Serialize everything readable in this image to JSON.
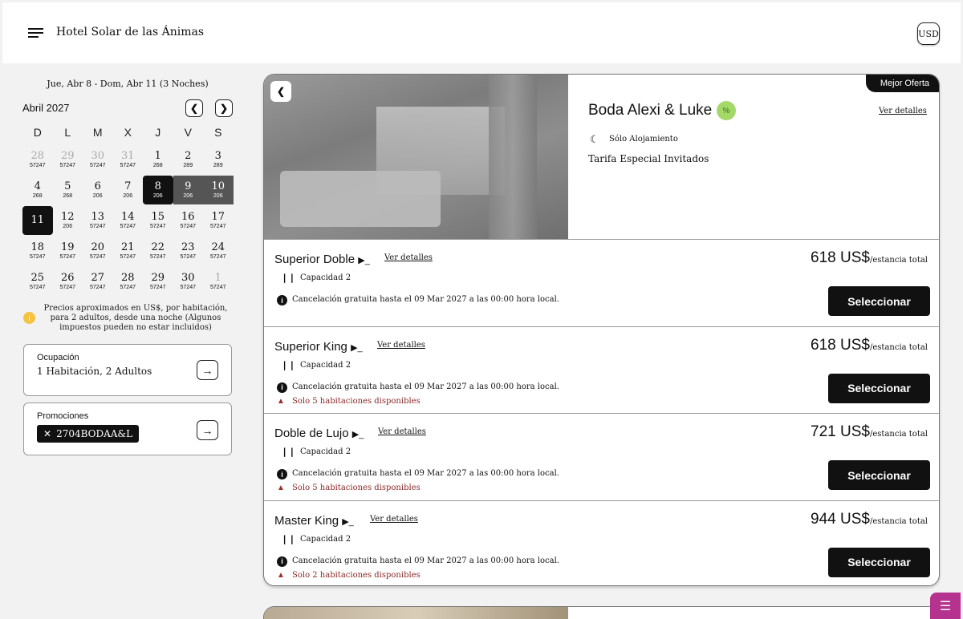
{
  "header": {
    "hotel_name": "Hotel Solar de las Ánimas",
    "currency": "USD"
  },
  "calendar": {
    "date_range": "Jue, Abr 8 - Dom, Abr 11 (3 Noches)",
    "month": "Abril 2027",
    "weekdays": [
      "D",
      "L",
      "M",
      "X",
      "J",
      "V",
      "S"
    ],
    "weeks": [
      [
        {
          "d": "28",
          "p": "57247",
          "muted": true
        },
        {
          "d": "29",
          "p": "57247",
          "muted": true
        },
        {
          "d": "30",
          "p": "57247",
          "muted": true
        },
        {
          "d": "31",
          "p": "57247",
          "muted": true
        },
        {
          "d": "1",
          "p": "268"
        },
        {
          "d": "2",
          "p": "289"
        },
        {
          "d": "3",
          "p": "289"
        }
      ],
      [
        {
          "d": "4",
          "p": "268"
        },
        {
          "d": "5",
          "p": "268"
        },
        {
          "d": "6",
          "p": "206"
        },
        {
          "d": "7",
          "p": "206"
        },
        {
          "d": "8",
          "p": "206",
          "state": "sel"
        },
        {
          "d": "9",
          "p": "206",
          "state": "mid"
        },
        {
          "d": "10",
          "p": "206",
          "state": "mid"
        }
      ],
      [
        {
          "d": "11",
          "p": "",
          "state": "sel-end"
        },
        {
          "d": "12",
          "p": "206"
        },
        {
          "d": "13",
          "p": "57247"
        },
        {
          "d": "14",
          "p": "57247"
        },
        {
          "d": "15",
          "p": "57247"
        },
        {
          "d": "16",
          "p": "57247"
        },
        {
          "d": "17",
          "p": "57247"
        }
      ],
      [
        {
          "d": "18",
          "p": "57247"
        },
        {
          "d": "19",
          "p": "57247"
        },
        {
          "d": "20",
          "p": "57247"
        },
        {
          "d": "21",
          "p": "57247"
        },
        {
          "d": "22",
          "p": "57247"
        },
        {
          "d": "23",
          "p": "57247"
        },
        {
          "d": "24",
          "p": "57247"
        }
      ],
      [
        {
          "d": "25",
          "p": "57247"
        },
        {
          "d": "26",
          "p": "57247"
        },
        {
          "d": "27",
          "p": "57247"
        },
        {
          "d": "28",
          "p": "57247"
        },
        {
          "d": "29",
          "p": "57247"
        },
        {
          "d": "30",
          "p": "57247"
        },
        {
          "d": "1",
          "p": "57247",
          "muted": true
        }
      ]
    ],
    "note": "Precios aproximados en US$, por habitación, para 2 adultos, desde una noche (Algunos impuestos pueden no estar incluidos)"
  },
  "occupancy": {
    "label": "Ocupación",
    "value": "1 Habitación, 2 Adultos"
  },
  "promotions": {
    "label": "Promociones",
    "code": "2704BODAA&L"
  },
  "rate": {
    "best_offer": "Mejor Oferta",
    "title": "Boda Alexi & Luke",
    "badge": "%",
    "details": "Ver detalles",
    "meal_plan": "Sólo Alojamiento",
    "description": "Tarifa Especial Invitados"
  },
  "rooms": [
    {
      "name": "Superior Doble",
      "details": "Ver detalles",
      "capacity": "Capacidad 2",
      "cancel": "Cancelación gratuita hasta el 09 Mar 2027 a las 00:00 hora local.",
      "warning": "",
      "price": "618 US$",
      "price_unit": "/estancia total",
      "button": "Seleccionar"
    },
    {
      "name": "Superior King",
      "details": "Ver detalles",
      "capacity": "Capacidad 2",
      "cancel": "Cancelación gratuita hasta el 09 Mar 2027 a las 00:00 hora local.",
      "warning": "Solo 5 habitaciones disponibles",
      "price": "618 US$",
      "price_unit": "/estancia total",
      "button": "Seleccionar"
    },
    {
      "name": "Doble de Lujo",
      "details": "Ver detalles",
      "capacity": "Capacidad 2",
      "cancel": "Cancelación gratuita hasta el 09 Mar 2027 a las 00:00 hora local.",
      "warning": "Solo 5 habitaciones disponibles",
      "price": "721 US$",
      "price_unit": "/estancia total",
      "button": "Seleccionar"
    },
    {
      "name": "Master King",
      "details": "Ver detalles",
      "capacity": "Capacidad 2",
      "cancel": "Cancelación gratuita hasta el 09 Mar 2027 a las 00:00 hora local.",
      "warning": "Solo 2 habitaciones disponibles",
      "price": "944 US$",
      "price_unit": "/estancia total",
      "button": "Seleccionar"
    }
  ]
}
